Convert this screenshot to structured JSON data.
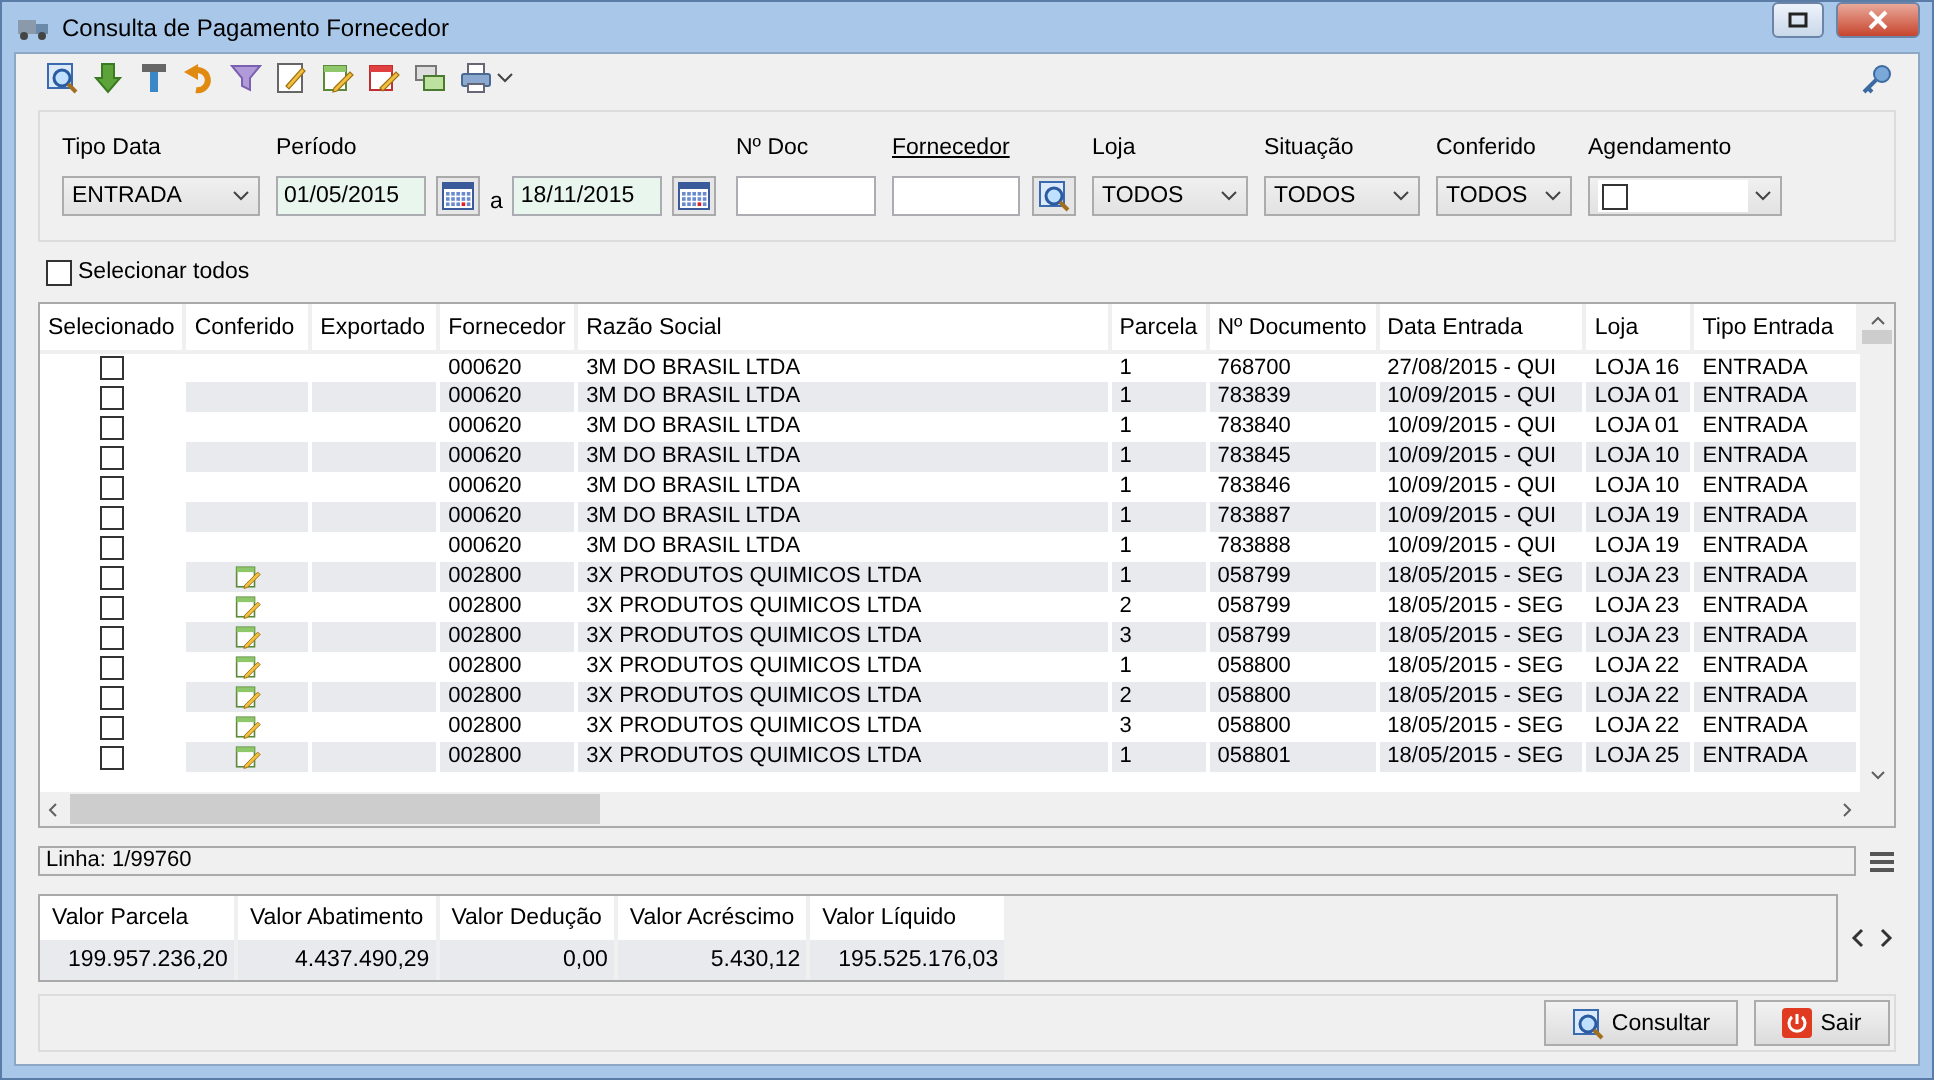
{
  "window": {
    "title": "Consulta de Pagamento Fornecedor"
  },
  "filters": {
    "tipo_data": {
      "label": "Tipo Data",
      "value": "ENTRADA"
    },
    "periodo": {
      "label": "Período",
      "from": "01/05/2015",
      "separator": "a",
      "to": "18/11/2015"
    },
    "n_doc": {
      "label": "Nº Doc"
    },
    "fornecedor": {
      "label": "Fornecedor"
    },
    "loja": {
      "label": "Loja",
      "value": "TODOS"
    },
    "situacao": {
      "label": "Situação",
      "value": "TODOS"
    },
    "conferido": {
      "label": "Conferido",
      "value": "TODOS"
    },
    "agendamento": {
      "label": "Agendamento",
      "checked": false
    }
  },
  "select_all": {
    "label": "Selecionar todos",
    "checked": false
  },
  "table": {
    "columns": [
      "Selecionado",
      "Conferido",
      "Exportado",
      "Fornecedor",
      "Razão Social",
      "Parcela",
      "Nº Documento",
      "Data Entrada",
      "Loja",
      "Tipo Entrada"
    ],
    "rows": [
      {
        "checked": false,
        "conferido": false,
        "fornecedor": "000620",
        "razao": "3M DO BRASIL LTDA",
        "parcela": "1",
        "documento": "768700",
        "data": "27/08/2015 - QUI",
        "loja": "LOJA 16",
        "tipo": "ENTRADA"
      },
      {
        "checked": false,
        "conferido": false,
        "fornecedor": "000620",
        "razao": "3M DO BRASIL LTDA",
        "parcela": "1",
        "documento": "783839",
        "data": "10/09/2015 - QUI",
        "loja": "LOJA 01",
        "tipo": "ENTRADA"
      },
      {
        "checked": false,
        "conferido": false,
        "fornecedor": "000620",
        "razao": "3M DO BRASIL LTDA",
        "parcela": "1",
        "documento": "783840",
        "data": "10/09/2015 - QUI",
        "loja": "LOJA 01",
        "tipo": "ENTRADA"
      },
      {
        "checked": false,
        "conferido": false,
        "fornecedor": "000620",
        "razao": "3M DO BRASIL LTDA",
        "parcela": "1",
        "documento": "783845",
        "data": "10/09/2015 - QUI",
        "loja": "LOJA 10",
        "tipo": "ENTRADA"
      },
      {
        "checked": false,
        "conferido": false,
        "fornecedor": "000620",
        "razao": "3M DO BRASIL LTDA",
        "parcela": "1",
        "documento": "783846",
        "data": "10/09/2015 - QUI",
        "loja": "LOJA 10",
        "tipo": "ENTRADA"
      },
      {
        "checked": false,
        "conferido": false,
        "fornecedor": "000620",
        "razao": "3M DO BRASIL LTDA",
        "parcela": "1",
        "documento": "783887",
        "data": "10/09/2015 - QUI",
        "loja": "LOJA 19",
        "tipo": "ENTRADA"
      },
      {
        "checked": false,
        "conferido": false,
        "fornecedor": "000620",
        "razao": "3M DO BRASIL LTDA",
        "parcela": "1",
        "documento": "783888",
        "data": "10/09/2015 - QUI",
        "loja": "LOJA 19",
        "tipo": "ENTRADA"
      },
      {
        "checked": false,
        "conferido": true,
        "fornecedor": "002800",
        "razao": "3X PRODUTOS QUIMICOS LTDA",
        "parcela": "1",
        "documento": "058799",
        "data": "18/05/2015 - SEG",
        "loja": "LOJA 23",
        "tipo": "ENTRADA"
      },
      {
        "checked": false,
        "conferido": true,
        "fornecedor": "002800",
        "razao": "3X PRODUTOS QUIMICOS LTDA",
        "parcela": "2",
        "documento": "058799",
        "data": "18/05/2015 - SEG",
        "loja": "LOJA 23",
        "tipo": "ENTRADA"
      },
      {
        "checked": false,
        "conferido": true,
        "fornecedor": "002800",
        "razao": "3X PRODUTOS QUIMICOS LTDA",
        "parcela": "3",
        "documento": "058799",
        "data": "18/05/2015 - SEG",
        "loja": "LOJA 23",
        "tipo": "ENTRADA"
      },
      {
        "checked": false,
        "conferido": true,
        "fornecedor": "002800",
        "razao": "3X PRODUTOS QUIMICOS LTDA",
        "parcela": "1",
        "documento": "058800",
        "data": "18/05/2015 - SEG",
        "loja": "LOJA 22",
        "tipo": "ENTRADA"
      },
      {
        "checked": false,
        "conferido": true,
        "fornecedor": "002800",
        "razao": "3X PRODUTOS QUIMICOS LTDA",
        "parcela": "2",
        "documento": "058800",
        "data": "18/05/2015 - SEG",
        "loja": "LOJA 22",
        "tipo": "ENTRADA"
      },
      {
        "checked": false,
        "conferido": true,
        "fornecedor": "002800",
        "razao": "3X PRODUTOS QUIMICOS LTDA",
        "parcela": "3",
        "documento": "058800",
        "data": "18/05/2015 - SEG",
        "loja": "LOJA 22",
        "tipo": "ENTRADA"
      },
      {
        "checked": false,
        "conferido": true,
        "fornecedor": "002800",
        "razao": "3X PRODUTOS QUIMICOS LTDA",
        "parcela": "1",
        "documento": "058801",
        "data": "18/05/2015 - SEG",
        "loja": "LOJA 25",
        "tipo": "ENTRADA"
      }
    ]
  },
  "status": {
    "text": "Linha: 1/99760"
  },
  "totals": [
    {
      "label": "Valor Parcela",
      "value": "199.957.236,20"
    },
    {
      "label": "Valor Abatimento",
      "value": "4.437.490,29"
    },
    {
      "label": "Valor Dedução",
      "value": "0,00"
    },
    {
      "label": "Valor Acréscimo",
      "value": "5.430,12"
    },
    {
      "label": "Valor Líquido",
      "value": "195.525.176,03"
    }
  ],
  "buttons": [
    {
      "kind": "search",
      "label": "Consultar"
    },
    {
      "kind": "exit",
      "label": "Sair"
    }
  ]
}
